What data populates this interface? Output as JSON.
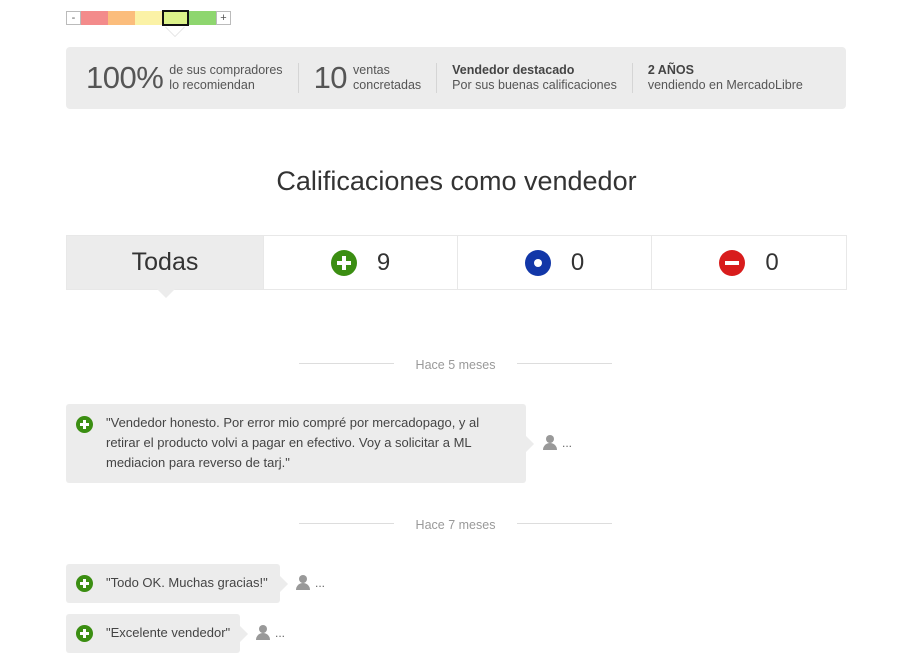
{
  "thermometer": {
    "minus": "-",
    "plus": "+",
    "segments": [
      "#f38b8b",
      "#fbbd7c",
      "#fbf2a6",
      "#dcf28a",
      "#8ed66f"
    ],
    "active_index": 3
  },
  "stats": {
    "recommend": {
      "big": "100%",
      "line1": "de sus compradores",
      "line2": "lo recomiendan"
    },
    "sales": {
      "big": "10",
      "line1": "ventas",
      "line2": "concretadas"
    },
    "featured": {
      "line1": "Vendedor destacado",
      "line2": "Por sus buenas calificaciones"
    },
    "years": {
      "line1": "2 AÑOS",
      "line2": "vendiendo en MercadoLibre"
    }
  },
  "title": "Calificaciones como vendedor",
  "tabs": {
    "all": "Todas",
    "positive": "9",
    "neutral": "0",
    "negative": "0"
  },
  "colors": {
    "positive": "#3b8e12",
    "neutral": "#1237a8",
    "negative": "#d81c1c"
  },
  "groups": [
    {
      "date": "Hace 5 meses",
      "reviews": [
        {
          "text": "\"Vendedor honesto. Por error mio compré por mercadopago, y al retirar el producto volvi a pagar en efectivo. Voy a solicitar a ML mediacion para reverso de tarj.\"",
          "user": "...",
          "icon": "plus-circle-icon"
        }
      ]
    },
    {
      "date": "Hace 7 meses",
      "reviews": [
        {
          "text": "\"Todo OK. Muchas gracias!\"",
          "user": "...",
          "icon": "plus-circle-icon"
        },
        {
          "text": "\"Excelente vendedor\"",
          "user": "...",
          "icon": "plus-circle-icon"
        }
      ]
    }
  ]
}
